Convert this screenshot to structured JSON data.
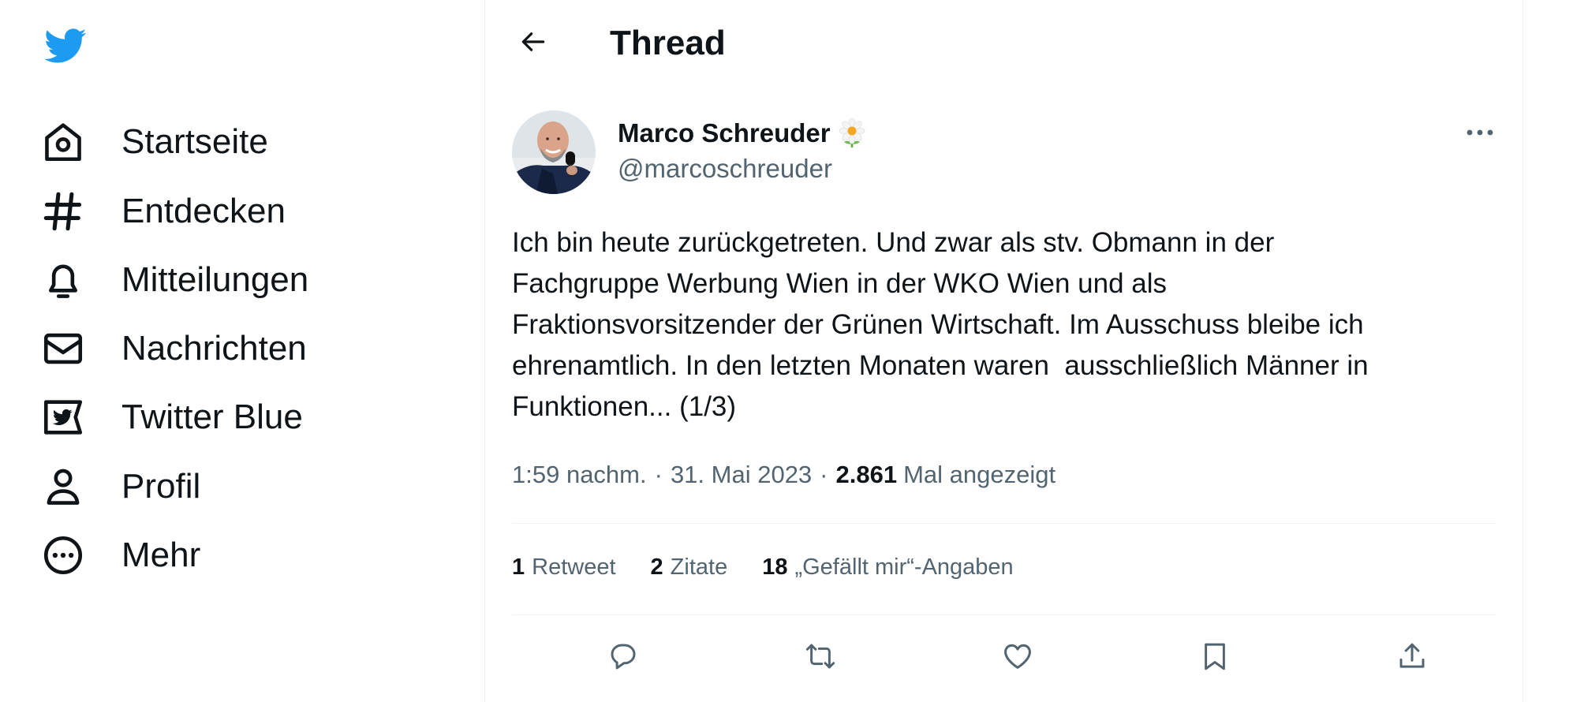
{
  "sidebar": {
    "items": [
      {
        "label": "Startseite",
        "icon": "home-icon"
      },
      {
        "label": "Entdecken",
        "icon": "hashtag-icon"
      },
      {
        "label": "Mitteilungen",
        "icon": "bell-icon"
      },
      {
        "label": "Nachrichten",
        "icon": "envelope-icon"
      },
      {
        "label": "Twitter Blue",
        "icon": "twitter-blue-icon"
      },
      {
        "label": "Profil",
        "icon": "person-icon"
      },
      {
        "label": "Mehr",
        "icon": "more-circle-icon"
      }
    ]
  },
  "header": {
    "title": "Thread"
  },
  "tweet": {
    "author_name": "Marco Schreuder",
    "author_handle": "@marcoschreuder",
    "text": "Ich bin heute zurückgetreten. Und zwar als stv. Obmann in der\nFachgruppe Werbung Wien in der WKO Wien und als\nFraktionsvorsitzender der Grünen Wirtschaft. Im Ausschuss bleibe ich\nehrenamtlich. In den letzten Monaten waren  ausschließlich Männer in\nFunktionen... (1/3)",
    "time": "1:59 nachm.",
    "date": "31. Mai 2023",
    "separator": "·",
    "views_count": "2.861",
    "views_label": "Mal angezeigt",
    "stats": {
      "retweets": {
        "count": "1",
        "label": "Retweet"
      },
      "quotes": {
        "count": "2",
        "label": "Zitate"
      },
      "likes": {
        "count": "18",
        "label": "„Gefällt mir“-Angaben"
      }
    }
  },
  "colors": {
    "brand": "#1d9bf0",
    "text": "#0f1419",
    "secondary": "#536471",
    "divider": "#eff3f4"
  }
}
